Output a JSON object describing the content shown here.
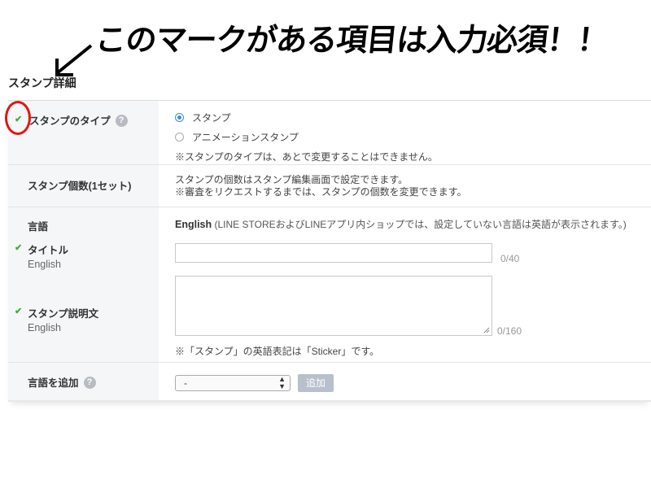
{
  "annotation": {
    "text": "このマークがある項目は入力必須！！"
  },
  "section": {
    "title": "スタンプ詳細"
  },
  "rows": {
    "type": {
      "label": "スタンプのタイプ",
      "options": [
        "スタンプ",
        "アニメーションスタンプ"
      ],
      "selected": "スタンプ",
      "note": "※スタンプのタイプは、あとで変更することはできません。"
    },
    "count": {
      "label": "スタンプ個数(1セット)",
      "line1": "スタンプの個数はスタンプ編集画面で設定できます。",
      "line2": "※審査をリクエストするまでは、スタンプの個数を変更できます。"
    },
    "language": {
      "label": "言語",
      "lang_name": "English",
      "lang_note": "(LINE STOREおよびLINEアプリ内ショップでは、設定していない言語は英語が表示されます。)",
      "title_label": "タイトル",
      "title_sub": "English",
      "title_value": "",
      "title_counter": "0/40",
      "desc_label": "スタンプ説明文",
      "desc_sub": "English",
      "desc_value": "",
      "desc_counter": "0/160",
      "footnote": "※「スタンプ」の英語表記は「Sticker」です。"
    },
    "add_language": {
      "label": "言語を追加",
      "select_value": "-",
      "button": "追加"
    }
  },
  "icons": {
    "check": "check-icon",
    "help": "help-icon",
    "arrow": "arrow-icon"
  },
  "colors": {
    "check": "#3eae3e",
    "accent": "#3b8de2",
    "highlight": "#e01616"
  }
}
